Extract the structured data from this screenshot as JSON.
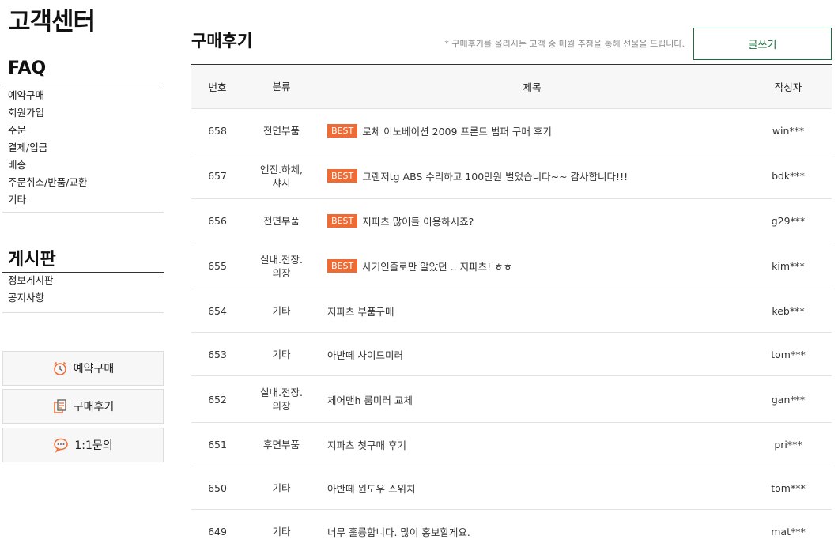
{
  "sidebar": {
    "title": "고객센터",
    "faq": {
      "title": "FAQ",
      "items": [
        "예약구매",
        "회원가입",
        "주문",
        "결제/입금",
        "배송",
        "주문취소/반품/교환",
        "기타"
      ]
    },
    "board": {
      "title": "게시판",
      "items": [
        "정보게시판",
        "공지사항"
      ]
    },
    "quick": [
      {
        "label": "예약구매",
        "icon": "alarm-clock-icon"
      },
      {
        "label": "구매후기",
        "icon": "document-icon"
      },
      {
        "label": "1:1문의",
        "icon": "chat-bubble-icon"
      }
    ]
  },
  "main": {
    "title": "구매후기",
    "notice": "* 구매후기를 올리시는 고객 중 매월 추첨을 통해 선물을 드립니다.",
    "write_label": "글쓰기",
    "columns": {
      "no": "번호",
      "category": "분류",
      "title": "제목",
      "author": "작성자"
    },
    "best_label": "BEST",
    "rows": [
      {
        "no": "658",
        "category": "전면부품",
        "title": "로체 이노베이션 2009 프론트 범퍼 구매 후기",
        "author": "win***",
        "best": true
      },
      {
        "no": "657",
        "category": "엔진.하체,\n샤시",
        "title": "그랜저tg ABS 수리하고 100만원 벌었습니다~~ 감사합니다!!!",
        "author": "bdk***",
        "best": true
      },
      {
        "no": "656",
        "category": "전면부품",
        "title": "지파츠 많이들 이용하시죠?",
        "author": "g29***",
        "best": true
      },
      {
        "no": "655",
        "category": "실내.전장.\n의장",
        "title": "사기인줄로만 알았던 .. 지파츠! ㅎㅎ",
        "author": "kim***",
        "best": true
      },
      {
        "no": "654",
        "category": "기타",
        "title": "지파츠 부품구매",
        "author": "keb***",
        "best": false
      },
      {
        "no": "653",
        "category": "기타",
        "title": "아반떼 사이드미러",
        "author": "tom***",
        "best": false
      },
      {
        "no": "652",
        "category": "실내.전장.\n의장",
        "title": "체어맨h 룸미러 교체",
        "author": "gan***",
        "best": false
      },
      {
        "no": "651",
        "category": "후면부품",
        "title": "지파츠 첫구매 후기",
        "author": "pri***",
        "best": false
      },
      {
        "no": "650",
        "category": "기타",
        "title": "아반떼 윈도우 스위치",
        "author": "tom***",
        "best": false
      },
      {
        "no": "649",
        "category": "기타",
        "title": "너무 훌륭합니다. 많이 홍보할게요.",
        "author": "mat***",
        "best": false
      }
    ]
  },
  "colors": {
    "best_badge": "#ef6b35",
    "write_button": "#1f6b3d",
    "icon_accent": "#ef6b35"
  }
}
